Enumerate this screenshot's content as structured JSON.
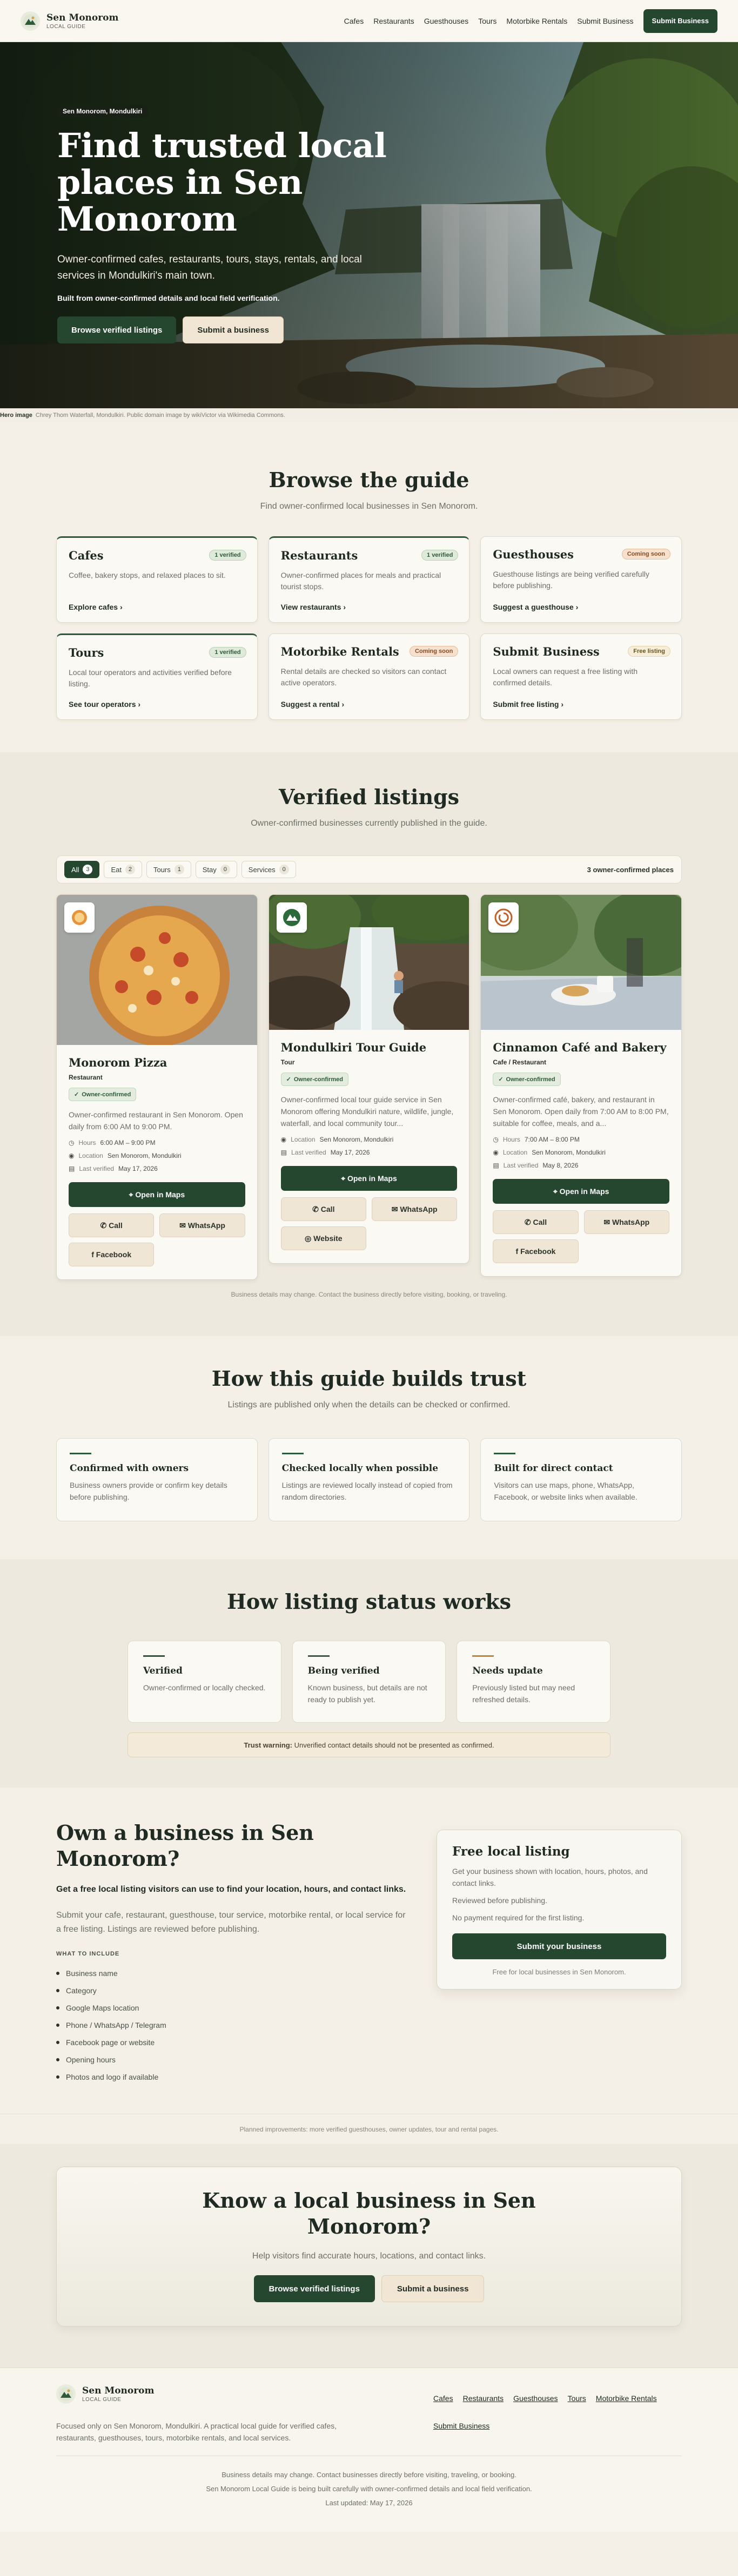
{
  "header": {
    "brand": "Sen Monorom",
    "brand_sub": "Local Guide",
    "nav": [
      "Cafes",
      "Restaurants",
      "Guesthouses",
      "Tours",
      "Motorbike Rentals",
      "Submit Business"
    ],
    "cta": "Submit Business"
  },
  "hero": {
    "pill": "Sen Monorom, Mondulkiri",
    "title": "Find trusted local places in Sen Monorom",
    "lead": "Owner-confirmed cafes, restaurants, tours, stays, rentals, and local services in Mondulkiri's main town.",
    "small": "Built from owner-confirmed details and local field verification.",
    "primary": "Browse verified listings",
    "secondary": "Submit a business",
    "credit_label": "Hero image",
    "credit_text": "Chrey Thom Waterfall, Mondulkiri. Public domain image by wikiVictor via Wikimedia Commons."
  },
  "guide": {
    "title": "Browse the guide",
    "sub": "Find owner-confirmed local businesses in Sen Monorom.",
    "cats": [
      {
        "name": "Cafes",
        "badge": "1 verified",
        "desc": "Coffee, bakery stops, and relaxed places to sit.",
        "link": "Explore cafes"
      },
      {
        "name": "Restaurants",
        "badge": "1 verified",
        "desc": "Owner-confirmed places for meals and practical tourist stops.",
        "link": "View restaurants"
      },
      {
        "name": "Guesthouses",
        "badge": "Coming soon",
        "desc": "Guesthouse listings are being verified carefully before publishing.",
        "link": "Suggest a guesthouse"
      },
      {
        "name": "Tours",
        "badge": "1 verified",
        "desc": "Local tour operators and activities verified before listing.",
        "link": "See tour operators"
      },
      {
        "name": "Motorbike Rentals",
        "badge": "Coming soon",
        "desc": "Rental details are checked so visitors can contact active operators.",
        "link": "Suggest a rental"
      },
      {
        "name": "Submit Business",
        "badge": "Free listing",
        "desc": "Local owners can request a free listing with confirmed details.",
        "link": "Submit free listing"
      }
    ]
  },
  "listings": {
    "title": "Verified listings",
    "sub": "Owner-confirmed businesses currently published in the guide.",
    "filters": [
      {
        "label": "All",
        "count": "3"
      },
      {
        "label": "Eat",
        "count": "2"
      },
      {
        "label": "Tours",
        "count": "1"
      },
      {
        "label": "Stay",
        "count": "0"
      },
      {
        "label": "Services",
        "count": "0"
      }
    ],
    "count_text": "3 owner-confirmed places",
    "owner_badge": "Owner-confirmed",
    "hours_label": "Hours",
    "location_label": "Location",
    "verified_label": "Last verified",
    "maps": "Open in Maps",
    "call": "Call",
    "whatsapp": "WhatsApp",
    "facebook": "Facebook",
    "website": "Website",
    "items": [
      {
        "name": "Monorom Pizza",
        "type": "Restaurant",
        "desc": "Owner-confirmed restaurant in Sen Monorom. Open daily from 6:00 AM to 9:00 PM.",
        "hours": "6:00 AM – 9:00 PM",
        "location": "Sen Monorom, Mondulkiri",
        "verified": "May 17, 2026"
      },
      {
        "name": "Mondulkiri Tour Guide",
        "type": "Tour",
        "desc": "Owner-confirmed local tour guide service in Sen Monorom offering Mondulkiri nature, wildlife, jungle, waterfall, and local community tour...",
        "location": "Sen Monorom, Mondulkiri",
        "verified": "May 17, 2026"
      },
      {
        "name": "Cinnamon Café and Bakery",
        "type": "Cafe / Restaurant",
        "desc": "Owner-confirmed café, bakery, and restaurant in Sen Monorom. Open daily from 7:00 AM to 8:00 PM, suitable for coffee, meals, and a...",
        "hours": "7:00 AM – 8:00 PM",
        "location": "Sen Monorom, Mondulkiri",
        "verified": "May 8, 2026"
      }
    ],
    "note": "Business details may change. Contact the business directly before visiting, booking, or traveling."
  },
  "trust": {
    "title": "How this guide builds trust",
    "sub": "Listings are published only when the details can be checked or confirmed.",
    "cards": [
      {
        "title": "Confirmed with owners",
        "desc": "Business owners provide or confirm key details before publishing."
      },
      {
        "title": "Checked locally when possible",
        "desc": "Listings are reviewed locally instead of copied from random directories."
      },
      {
        "title": "Built for direct contact",
        "desc": "Visitors can use maps, phone, WhatsApp, Facebook, or website links when available."
      }
    ]
  },
  "status": {
    "title": "How listing status works",
    "cards": [
      {
        "title": "Verified",
        "desc": "Owner-confirmed or locally checked.",
        "color": "#2c5a3a"
      },
      {
        "title": "Being verified",
        "desc": "Known business, but details are not ready to publish yet.",
        "color": "#3f5a4a"
      },
      {
        "title": "Needs update",
        "desc": "Previously listed but may need refreshed details.",
        "color": "#b98a3a"
      }
    ],
    "warn_label": "Trust warning:",
    "warn_text": "Unverified contact details should not be presented as confirmed."
  },
  "own": {
    "title": "Own a business in Sen Monorom?",
    "lead": "Get a free local listing visitors can use to find your location, hours, and contact links.",
    "desc": "Submit your cafe, restaurant, guesthouse, tour service, motorbike rental, or local service for a free listing. Listings are reviewed before publishing.",
    "include_label": "WHAT TO INCLUDE",
    "include": [
      "Business name",
      "Category",
      "Google Maps location",
      "Phone / WhatsApp / Telegram",
      "Facebook page or website",
      "Opening hours",
      "Photos and logo if available"
    ],
    "card_title": "Free local listing",
    "card_desc": "Get your business shown with location, hours, photos, and contact links.",
    "card_line2": "Reviewed before publishing.",
    "card_line3": "No payment required for the first listing.",
    "card_btn": "Submit your business",
    "card_note": "Free for local businesses in Sen Monorom."
  },
  "planned": "Planned improvements: more verified guesthouses, owner updates, tour and rental pages.",
  "cta": {
    "title": "Know a local business in Sen Monorom?",
    "sub": "Help visitors find accurate hours, locations, and contact links.",
    "primary": "Browse verified listings",
    "secondary": "Submit a business"
  },
  "footer": {
    "brand": "Sen Monorom",
    "brand_sub": "Local Guide",
    "desc": "Focused only on Sen Monorom, Mondulkiri. A practical local guide for verified cafes, restaurants, guesthouses, tours, motorbike rentals, and local services.",
    "links": [
      "Cafes",
      "Restaurants",
      "Guesthouses",
      "Tours",
      "Motorbike Rentals",
      "Submit Business"
    ],
    "line1": "Business details may change. Contact businesses directly before visiting, traveling, or booking.",
    "line2": "Sen Monorom Local Guide is being built carefully with owner-confirmed details and local field verification.",
    "line3": "Last updated: May 17, 2026"
  }
}
